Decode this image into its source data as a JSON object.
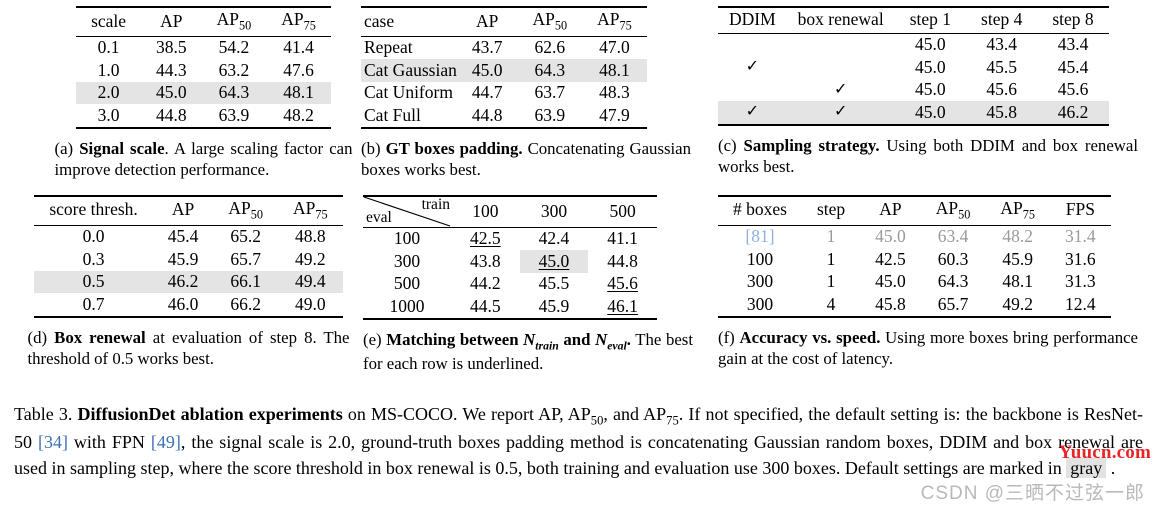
{
  "table_label": "Table 3.",
  "subtables": [
    {
      "id": "a",
      "columns": [
        "scale",
        "AP",
        "AP50",
        "AP75"
      ],
      "rows": [
        {
          "cells": [
            "0.1",
            "38.5",
            "54.2",
            "41.4"
          ],
          "highlight": false
        },
        {
          "cells": [
            "1.0",
            "44.3",
            "63.2",
            "47.6"
          ],
          "highlight": false
        },
        {
          "cells": [
            "2.0",
            "45.0",
            "64.3",
            "48.1"
          ],
          "highlight": true
        },
        {
          "cells": [
            "3.0",
            "44.8",
            "63.9",
            "48.2"
          ],
          "highlight": false
        }
      ],
      "caption_tag": "(a)",
      "caption_bold": "Signal scale",
      "caption_rest": ". A large scaling factor can improve detection performance."
    },
    {
      "id": "b",
      "columns": [
        "case",
        "AP",
        "AP50",
        "AP75"
      ],
      "rows": [
        {
          "cells": [
            "Repeat",
            "43.7",
            "62.6",
            "47.0"
          ],
          "highlight": false
        },
        {
          "cells": [
            "Cat Gaussian",
            "45.0",
            "64.3",
            "48.1"
          ],
          "highlight": true
        },
        {
          "cells": [
            "Cat Uniform",
            "44.7",
            "63.7",
            "48.3"
          ],
          "highlight": false
        },
        {
          "cells": [
            "Cat Full",
            "44.8",
            "63.9",
            "47.9"
          ],
          "highlight": false
        }
      ],
      "caption_tag": "(b)",
      "caption_bold": "GT boxes padding.",
      "caption_rest": " Concatenating Gaussian boxes works best."
    },
    {
      "id": "c",
      "columns": [
        "DDIM",
        "box renewal",
        "step 1",
        "step 4",
        "step 8"
      ],
      "check_glyph": "✓",
      "rows": [
        {
          "ddim": "",
          "renewal": "",
          "cells": [
            "45.0",
            "43.4",
            "43.4"
          ],
          "highlight": false
        },
        {
          "ddim": "✓",
          "renewal": "",
          "cells": [
            "45.0",
            "45.5",
            "45.4"
          ],
          "highlight": false
        },
        {
          "ddim": "",
          "renewal": "✓",
          "cells": [
            "45.0",
            "45.6",
            "45.6"
          ],
          "highlight": false
        },
        {
          "ddim": "✓",
          "renewal": "✓",
          "cells": [
            "45.0",
            "45.8",
            "46.2"
          ],
          "highlight": true
        }
      ],
      "caption_tag": "(c)",
      "caption_bold": "Sampling strategy.",
      "caption_rest": " Using both DDIM and box renewal works best."
    },
    {
      "id": "d",
      "columns": [
        "score thresh.",
        "AP",
        "AP50",
        "AP75"
      ],
      "rows": [
        {
          "cells": [
            "0.0",
            "45.4",
            "65.2",
            "48.8"
          ],
          "highlight": false
        },
        {
          "cells": [
            "0.3",
            "45.9",
            "65.7",
            "49.2"
          ],
          "highlight": false
        },
        {
          "cells": [
            "0.5",
            "46.2",
            "66.1",
            "49.4"
          ],
          "highlight": true
        },
        {
          "cells": [
            "0.7",
            "46.0",
            "66.2",
            "49.0"
          ],
          "highlight": false
        }
      ],
      "caption_tag": "(d)",
      "caption_bold": "Box renewal",
      "caption_rest": " at evaluation of step 8. The threshold of 0.5 works best."
    },
    {
      "id": "e",
      "corner_row_label": "eval",
      "corner_col_label": "train",
      "columns": [
        "100",
        "300",
        "500"
      ],
      "row_labels": [
        "100",
        "300",
        "500",
        "1000"
      ],
      "values": [
        [
          "42.5",
          "42.4",
          "41.1"
        ],
        [
          "43.8",
          "45.0",
          "44.8"
        ],
        [
          "44.2",
          "45.5",
          "45.6"
        ],
        [
          "44.5",
          "45.9",
          "46.1"
        ]
      ],
      "underlined": [
        [
          true,
          false,
          false
        ],
        [
          false,
          true,
          false
        ],
        [
          false,
          false,
          true
        ],
        [
          false,
          false,
          true
        ]
      ],
      "highlighted": [
        [
          false,
          false,
          false
        ],
        [
          false,
          true,
          false
        ],
        [
          false,
          false,
          false
        ],
        [
          false,
          false,
          false
        ]
      ],
      "caption_tag": "(e)",
      "caption_bold_1": "Matching between ",
      "caption_math_1": "N",
      "caption_math_1_sub": "train",
      "caption_bold_2": " and ",
      "caption_math_2": "N",
      "caption_math_2_sub": "eval",
      "caption_bold_3": ".",
      "caption_rest": " The best for each row is underlined."
    },
    {
      "id": "f",
      "columns": [
        "# boxes",
        "step",
        "AP",
        "AP50",
        "AP75",
        "FPS"
      ],
      "rows": [
        {
          "cells": [
            "[81]",
            "1",
            "45.0",
            "63.4",
            "48.2",
            "31.4"
          ],
          "faded": true,
          "cite": true
        },
        {
          "cells": [
            "100",
            "1",
            "42.5",
            "60.3",
            "45.9",
            "31.6"
          ],
          "faded": false,
          "cite": false
        },
        {
          "cells": [
            "300",
            "1",
            "45.0",
            "64.3",
            "48.1",
            "31.3"
          ],
          "faded": false,
          "cite": false
        },
        {
          "cells": [
            "300",
            "4",
            "45.8",
            "65.7",
            "49.2",
            "12.4"
          ],
          "faded": false,
          "cite": false
        }
      ],
      "caption_tag": "(f)",
      "caption_bold": "Accuracy vs. speed.",
      "caption_rest": " Using more boxes bring performance gain at the cost of latency."
    }
  ],
  "main_caption": {
    "label": "Table 3.",
    "bold": "DiffusionDet ablation experiments",
    "seg1": " on MS-COCO. We report AP, AP",
    "sub1": "50",
    "seg2": ", and AP",
    "sub2": "75",
    "seg3": ". If not specified, the default setting is: the backbone is ResNet-50 ",
    "cite1": "[34]",
    "seg4": " with FPN ",
    "cite2": "[49]",
    "seg5": ", the signal scale is 2.0, ground-truth boxes padding method is concatenating Gaussian random boxes, DDIM and box renewal are used in sampling step, where the score threshold in box renewal is 0.5, both training and evaluation use 300 boxes. Default settings are marked in ",
    "gray_word": "gray",
    "seg6": " ."
  },
  "watermarks": {
    "red": "Yuucn.com",
    "gray": "CSDN @三晒不过弦一郎",
    "red_color": "#e8191b",
    "gray_color": "#b9b9b9"
  },
  "colors": {
    "highlight_gray": "#e4e4e4",
    "citation_blue": "#3f6fb5",
    "faded_gray": "#9a9a9a"
  }
}
